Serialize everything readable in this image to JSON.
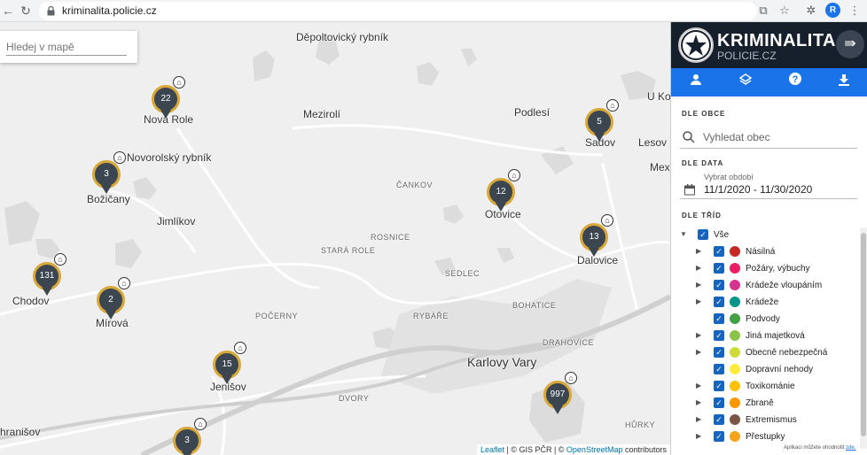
{
  "browser": {
    "url": "kriminalita.policie.cz",
    "avatar_letter": "R"
  },
  "map": {
    "search_placeholder": "Hledej v mapě",
    "places": [
      {
        "name": "Děpoltovický rybník",
        "class": "place"
      },
      {
        "name": "Nová Role",
        "class": "place"
      },
      {
        "name": "Mezirolí",
        "class": "place"
      },
      {
        "name": "Podlesí",
        "class": "place"
      },
      {
        "name": "U Kon",
        "class": "place small2"
      },
      {
        "name": "Novorolský rybník",
        "class": "place"
      },
      {
        "name": "Sadov",
        "class": "place"
      },
      {
        "name": "Lesov",
        "class": "place"
      },
      {
        "name": "Mexi",
        "class": "place"
      },
      {
        "name": "Božičany",
        "class": "place"
      },
      {
        "name": "ČANKOV",
        "class": "place small"
      },
      {
        "name": "Jimlíkov",
        "class": "place"
      },
      {
        "name": "Otovice",
        "class": "place"
      },
      {
        "name": "ROSNICE",
        "class": "place small"
      },
      {
        "name": "STARÁ ROLE",
        "class": "place small"
      },
      {
        "name": "Dalovice",
        "class": "place"
      },
      {
        "name": "SEDLEC",
        "class": "place small"
      },
      {
        "name": "Chodov",
        "class": "place"
      },
      {
        "name": "Mírová",
        "class": "place"
      },
      {
        "name": "BOHATICE",
        "class": "place small"
      },
      {
        "name": "POČERNY",
        "class": "place small"
      },
      {
        "name": "RYBÁŘE",
        "class": "place small"
      },
      {
        "name": "DRAHOVICE",
        "class": "place small"
      },
      {
        "name": "Karlovy Vary",
        "class": "place big"
      },
      {
        "name": "Jenišov",
        "class": "place"
      },
      {
        "name": "DVORY",
        "class": "place small"
      },
      {
        "name": "hranišov",
        "class": "place"
      },
      {
        "name": "HŮRKY",
        "class": "place small"
      }
    ],
    "markers": [
      {
        "name": "marker-nova-role",
        "count": "22"
      },
      {
        "name": "marker-sadov",
        "count": "5"
      },
      {
        "name": "marker-bozicany",
        "count": "3"
      },
      {
        "name": "marker-otovice",
        "count": "12"
      },
      {
        "name": "marker-dalovice",
        "count": "13"
      },
      {
        "name": "marker-chodov",
        "count": "131"
      },
      {
        "name": "marker-mirova",
        "count": "2"
      },
      {
        "name": "marker-jenisov",
        "count": "15"
      },
      {
        "name": "marker-karlovy-vary",
        "count": "997"
      },
      {
        "name": "marker-south",
        "count": "3"
      }
    ],
    "attribution": {
      "leaflet": "Leaflet",
      "sep": " | © GIS PČR | © ",
      "osm": "OpenStreetMap",
      "rest": " contributors"
    }
  },
  "panel": {
    "brand": "KRIMINALITA",
    "subbrand": "POLICIE.CZ",
    "tabs": [
      {
        "name": "tab-user",
        "icon": "person-icon"
      },
      {
        "name": "tab-layers",
        "icon": "layers-icon"
      },
      {
        "name": "tab-help",
        "icon": "help-icon"
      },
      {
        "name": "tab-download",
        "icon": "download-icon"
      }
    ],
    "section_obec": "DLE OBCE",
    "obec_placeholder": "Vyhledat obec",
    "section_data": "DLE DATA",
    "period_label": "Vybrat období",
    "period_value": "11/1/2020 - 11/30/2020",
    "section_trid": "DLE TŘÍD",
    "classes": [
      {
        "label": "Vše",
        "color": "",
        "arrow": "▼",
        "indent": 0
      },
      {
        "label": "Násilná",
        "color": "#c62828",
        "arrow": "▶",
        "indent": 1
      },
      {
        "label": "Požáry, výbuchy",
        "color": "#e91e63",
        "arrow": "▶",
        "indent": 1
      },
      {
        "label": "Krádeže vloupáním",
        "color": "#d6338f",
        "arrow": "▶",
        "indent": 1
      },
      {
        "label": "Krádeže",
        "color": "#009688",
        "arrow": "▶",
        "indent": 1
      },
      {
        "label": "Podvody",
        "color": "#43a047",
        "arrow": "",
        "indent": 1
      },
      {
        "label": "Jiná majetková",
        "color": "#8bc34a",
        "arrow": "▶",
        "indent": 1
      },
      {
        "label": "Obecně nebezpečná",
        "color": "#cddc39",
        "arrow": "▶",
        "indent": 1
      },
      {
        "label": "Dopravní nehody",
        "color": "#ffeb3b",
        "arrow": "",
        "indent": 1
      },
      {
        "label": "Toxikománie",
        "color": "#ffc107",
        "arrow": "▶",
        "indent": 1
      },
      {
        "label": "Zbraně",
        "color": "#ff9800",
        "arrow": "▶",
        "indent": 1
      },
      {
        "label": "Extremismus",
        "color": "#795548",
        "arrow": "▶",
        "indent": 1
      },
      {
        "label": "Přestupky",
        "color": "#f4a31a",
        "arrow": "▶",
        "indent": 1
      }
    ],
    "footnote_text": "Aplikaci můžete ohodnotit ",
    "footnote_link": "zde."
  }
}
